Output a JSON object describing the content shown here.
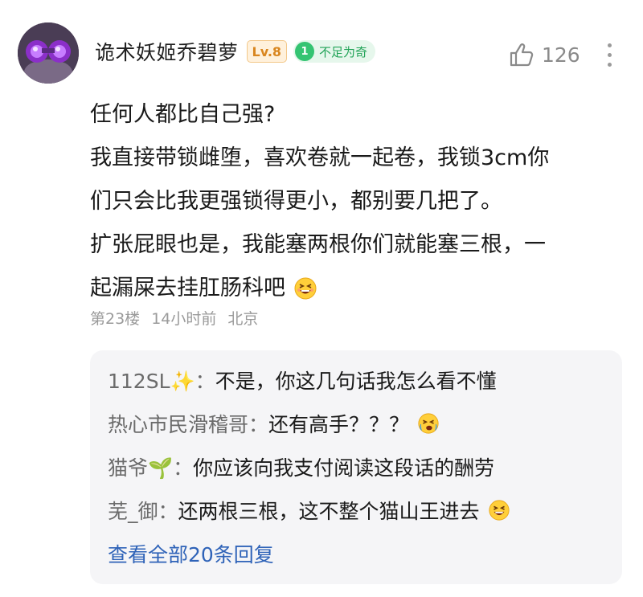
{
  "comment": {
    "username": "诡术妖姬乔碧萝",
    "level": "Lv.8",
    "fan_badge": {
      "number": "1",
      "label": "不足为奇"
    },
    "like_count": "126",
    "lines": [
      "任何人都比自己强?",
      "我直接带锁雌堕，喜欢卷就一起卷，我锁3cm你",
      "们只会比我更强锁得更小，都别要几把了。",
      "扩张屁眼也是，我能塞两根你们就能塞三根，一",
      "起漏屎去挂肛肠科吧"
    ],
    "floor": "第23楼",
    "time": "14小时前",
    "location": "北京"
  },
  "replies": [
    {
      "name": "112SL✨：",
      "text": "不是，你这几句话我怎么看不懂"
    },
    {
      "name": "热心市民滑稽哥：",
      "text": "还有高手？？？"
    },
    {
      "name": "猫爷🌱：",
      "text": "你应该向我支付阅读这段话的酬劳"
    },
    {
      "name": "芜_御：",
      "text": "还两根三根，这不整个猫山王进去"
    }
  ],
  "view_all": "查看全部20条回复",
  "icons": {
    "like": "thumbs-up-icon",
    "more": "more-vertical-icon",
    "emoji_grin": "grinning-squint-emoji-icon",
    "emoji_cry": "crying-laugh-emoji-icon"
  },
  "colors": {
    "level_text": "#d9861f",
    "fan_green": "#21a357",
    "link_blue": "#2f63b8",
    "meta_gray": "#9a9a9a"
  }
}
